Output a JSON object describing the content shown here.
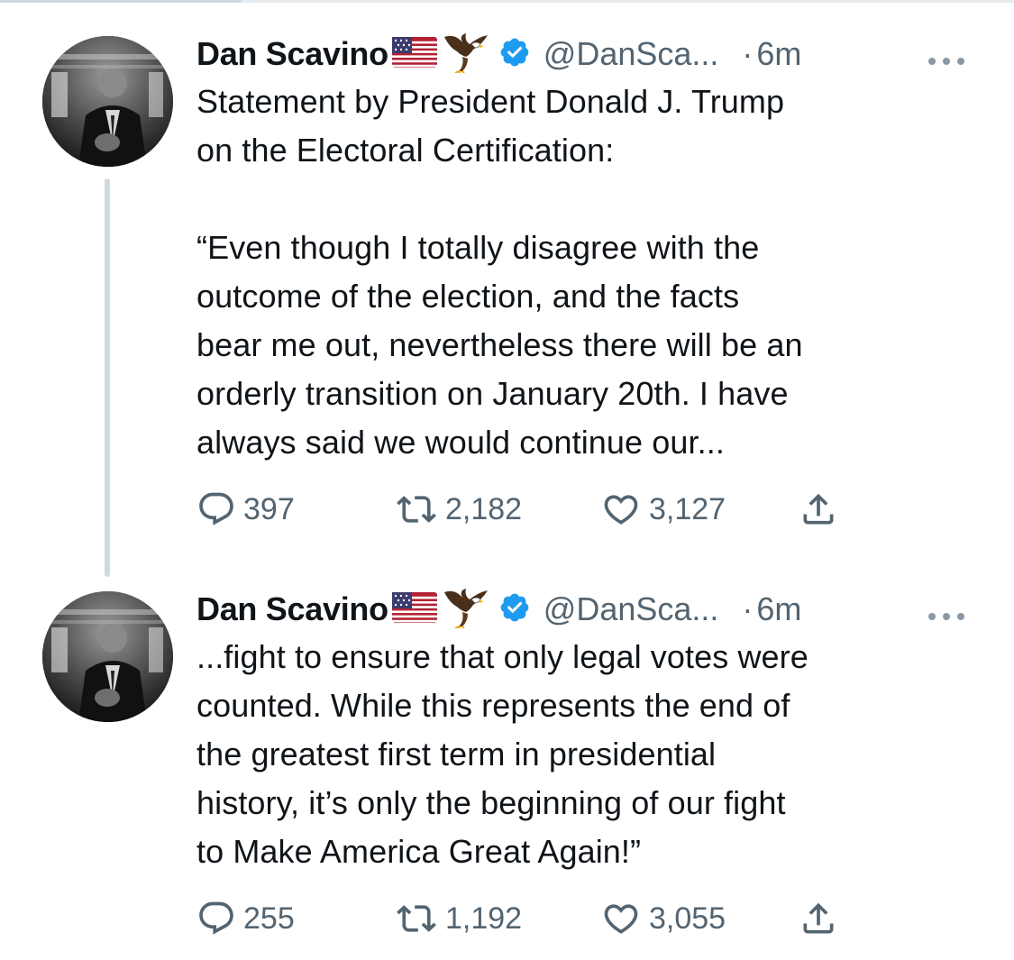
{
  "tweets": [
    {
      "author": {
        "name": "Dan Scavino",
        "handle": "@DanSca...",
        "verified": true
      },
      "separator": "·",
      "time": "6m",
      "text": "Statement by President Donald J. Trump\non the Electoral Certification:\n\n“Even though I totally disagree with the\noutcome of the election, and the facts\nbear me out, nevertheless there will be an\norderly transition on January 20th. I have\nalways said we would continue our...",
      "stats": {
        "replies": "397",
        "retweets": "2,182",
        "likes": "3,127"
      }
    },
    {
      "author": {
        "name": "Dan Scavino",
        "handle": "@DanSca...",
        "verified": true
      },
      "separator": "·",
      "time": "6m",
      "text": "...fight to ensure that only legal votes were\ncounted. While this represents the end of\nthe greatest first term in presidential\nhistory, it’s only the beginning of our fight\nto Make America Great Again!”",
      "stats": {
        "replies": "255",
        "retweets": "1,192",
        "likes": "3,055"
      }
    }
  ],
  "icons": {
    "reply": "reply-icon",
    "retweet": "retweet-icon",
    "like": "heart-icon",
    "share": "share-icon",
    "more": "more-icon",
    "verified": "verified-badge-icon",
    "flag": "us-flag-emoji",
    "eagle": "eagle-emoji"
  },
  "colors": {
    "text": "#0f1419",
    "secondary": "#536471",
    "verified": "#1d9bf0",
    "thread_line": "#cfd9de"
  }
}
